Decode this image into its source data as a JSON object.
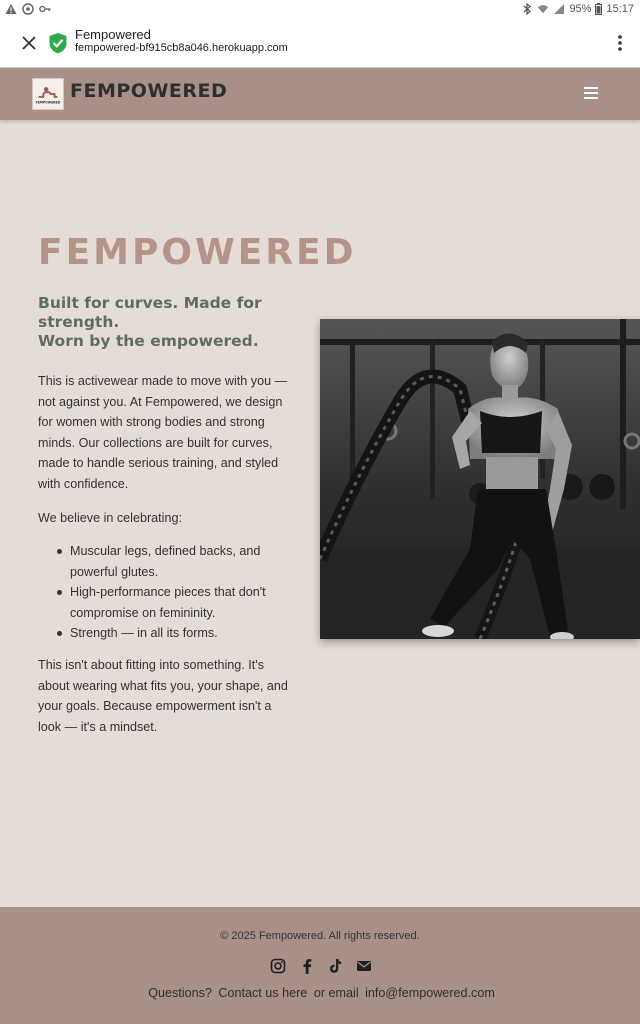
{
  "status_bar": {
    "battery": "95%",
    "time": "15:17"
  },
  "browser_tab": {
    "title": "Fempowered",
    "url": "fempowered-bf915cb8a046.herokuapp.com",
    "icons": {
      "close": "close-icon",
      "secure": "shield-check-icon",
      "menu": "more-vert-icon"
    }
  },
  "site_header": {
    "brand": "FEMPOWERED",
    "logo_caption": "FEMPOWERED",
    "menu_icon": "hamburger-icon"
  },
  "main": {
    "heading": "FEMPOWERED",
    "tagline": [
      "Built for curves. Made for strength.",
      "Worn by the empowered."
    ],
    "intro": "This is activewear made to move with you — not against you. At Fempowered, we design for women with strong bodies and strong minds. Our collections are built for curves, made to handle serious training, and styled with confidence.",
    "beliefs_intro": "We believe in celebrating:",
    "beliefs": [
      "Muscular legs, defined backs, and powerful glutes.",
      "High-performance pieces that don't compromise on femininity.",
      "Strength — in all its forms."
    ],
    "closing": "This isn't about fitting into something. It's about wearing what fits you, your shape, and your goals. Because empowerment isn't a look — it's a mindset.",
    "hero_image": "woman-battle-ropes-photo"
  },
  "footer": {
    "copyright": "© 2025 Fempowered. All rights reserved.",
    "social_icons": [
      "instagram-icon",
      "facebook-icon",
      "tiktok-icon",
      "email-icon"
    ],
    "questions": "Questions?",
    "contact_link": "Contact us here",
    "or_email": "or email",
    "email": "info@fempowered.com"
  },
  "colors": {
    "brand_mauve": "#a88f88",
    "page_background": "#e5dcd7",
    "heading_rose": "#b49388",
    "tagline_green": "#5f6d61"
  }
}
